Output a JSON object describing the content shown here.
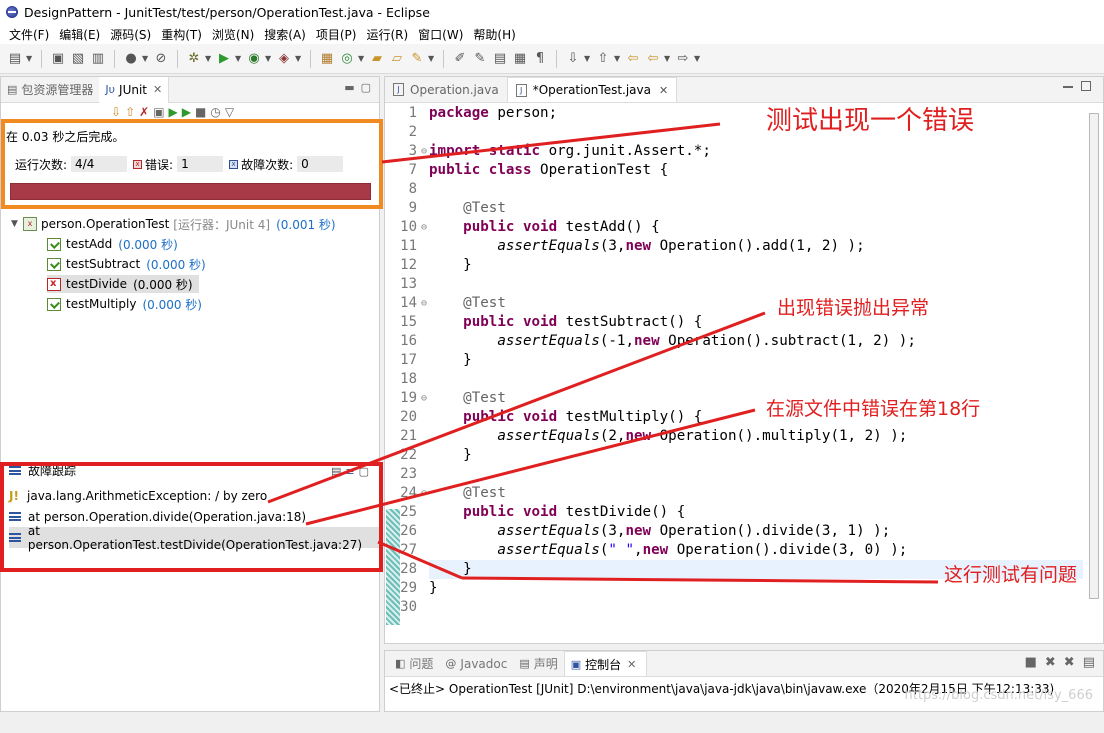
{
  "window": {
    "title": "DesignPattern - JunitTest/test/person/OperationTest.java - Eclipse"
  },
  "menu": [
    "文件(F)",
    "编辑(E)",
    "源码(S)",
    "重构(T)",
    "浏览(N)",
    "搜索(A)",
    "项目(P)",
    "运行(R)",
    "窗口(W)",
    "帮助(H)"
  ],
  "left_view": {
    "tabs": [
      {
        "label": "包资源管理器",
        "icon": "package-explorer-icon"
      },
      {
        "label": "JUnit",
        "icon": "junit-icon"
      }
    ],
    "status": "在 0.03 秒之后完成。",
    "runs_label": "运行次数:",
    "runs_value": "4/4",
    "errors_label": "错误:",
    "errors_value": "1",
    "failures_label": "故障次数:",
    "failures_value": "0",
    "progress_color": "#a83a47",
    "tree": {
      "suite_name": "person.OperationTest",
      "suite_runner": "[运行器：JUnit 4]",
      "suite_time": "(0.001 秒)",
      "tests": [
        {
          "name": "testAdd",
          "time": "(0.000 秒)",
          "status": "pass"
        },
        {
          "name": "testSubtract",
          "time": "(0.000 秒)",
          "status": "pass"
        },
        {
          "name": "testDivide",
          "time": "(0.000 秒)",
          "status": "error"
        },
        {
          "name": "testMultiply",
          "time": "(0.000 秒)",
          "status": "pass"
        }
      ]
    },
    "trace": {
      "header": "故障跟踪",
      "lines": [
        "java.lang.ArithmeticException: / by zero",
        "at person.Operation.divide(Operation.java:18)",
        "at person.OperationTest.testDivide(OperationTest.java:27)"
      ]
    }
  },
  "editor": {
    "tabs": [
      {
        "label": "Operation.java",
        "active": false
      },
      {
        "label": "*OperationTest.java",
        "active": true
      }
    ],
    "line_numbers": [
      "1",
      "2",
      "3",
      "7",
      "8",
      "9",
      "10",
      "11",
      "12",
      "13",
      "14",
      "15",
      "16",
      "17",
      "18",
      "19",
      "20",
      "21",
      "22",
      "23",
      "24",
      "25",
      "26",
      "27",
      "28",
      "29",
      "30"
    ],
    "lines": [
      "package person;",
      "",
      "import static org.junit.Assert.*;",
      "public class OperationTest {",
      "",
      "    @Test",
      "    public void testAdd() {",
      "        assertEquals(3,new Operation().add(1, 2) );",
      "    }",
      "",
      "    @Test",
      "    public void testSubtract() {",
      "        assertEquals(-1,new Operation().subtract(1, 2) );",
      "    }",
      "",
      "    @Test",
      "    public void testMultiply() {",
      "        assertEquals(2,new Operation().multiply(1, 2) );",
      "    }",
      "",
      "    @Test",
      "    public void testDivide() {",
      "        assertEquals(3,new Operation().divide(3, 1) );",
      "        assertEquals(\" \",new Operation().divide(3, 0) );",
      "    }",
      "}",
      ""
    ]
  },
  "console": {
    "tabs": [
      {
        "label": "问题",
        "icon": "problems-icon"
      },
      {
        "label": "Javadoc",
        "icon": "javadoc-icon"
      },
      {
        "label": "声明",
        "icon": "declaration-icon"
      },
      {
        "label": "控制台",
        "icon": "console-icon"
      }
    ],
    "text": "<已终止> OperationTest [JUnit] D:\\environment\\java\\java-jdk\\java\\bin\\javaw.exe（2020年2月15日 下午12:13:33)",
    "watermark": "https://blog.csdn.net/lsy_666"
  },
  "annotations": {
    "a1": "测试出现一个错误",
    "a2": "出现错误抛出异常",
    "a3": "在源文件中错误在第18行",
    "a4": "这行测试有问题",
    "color": "#e02020"
  }
}
